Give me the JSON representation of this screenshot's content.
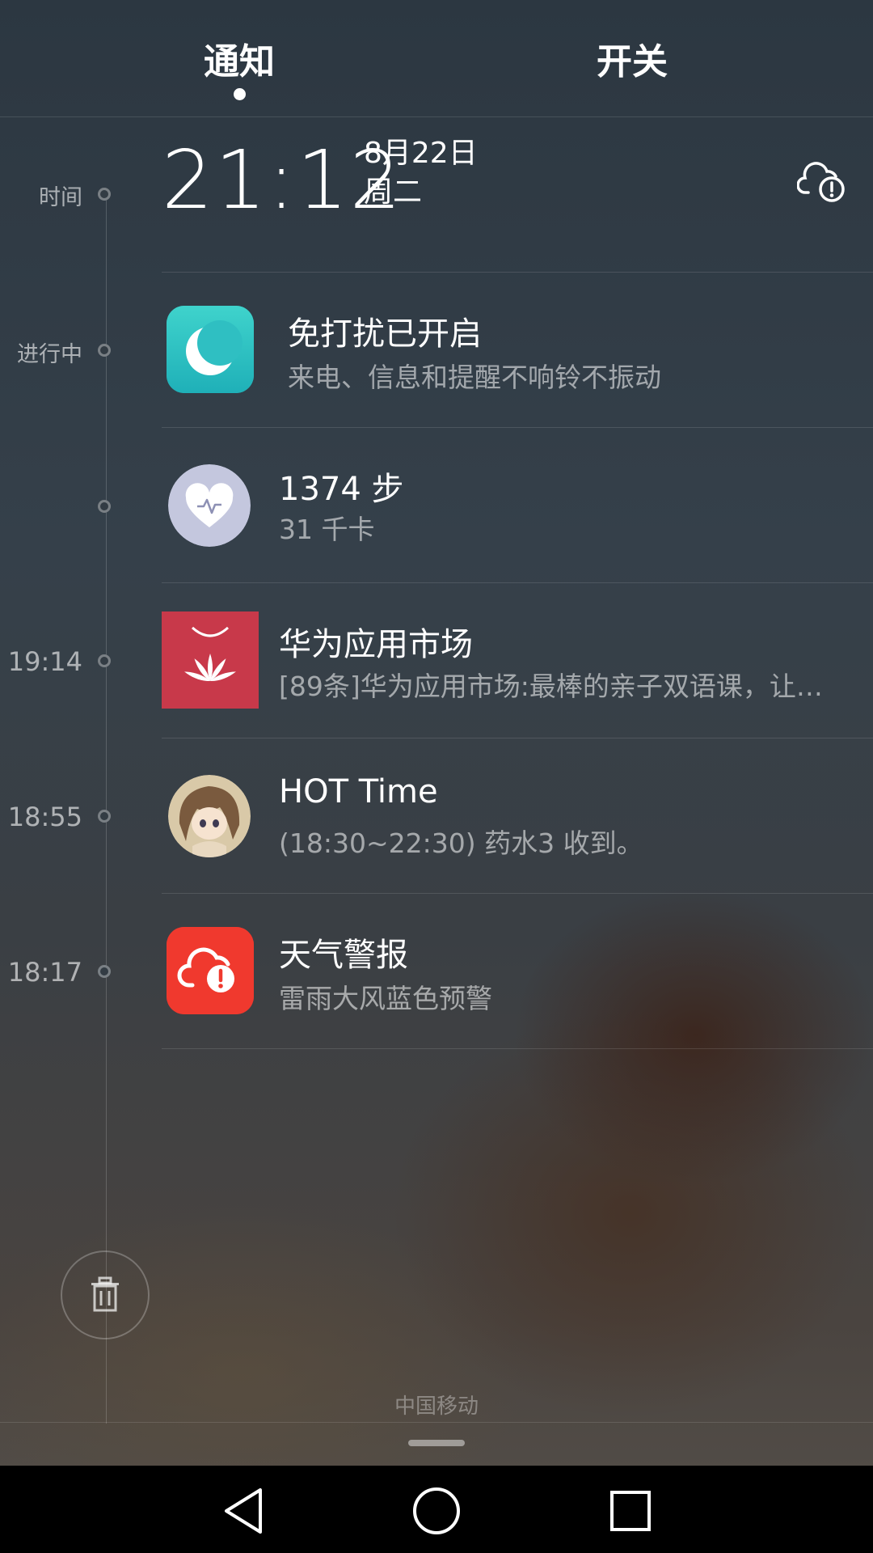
{
  "tabs": {
    "notify": "通知",
    "switch": "开关"
  },
  "timeline": {
    "time_label": "时间",
    "ongoing_label": "进行中",
    "t1": "19:14",
    "t2": "18:55",
    "t3": "18:17"
  },
  "clock": {
    "time": "21:12",
    "date": "8月22日",
    "weekday": "周二"
  },
  "notifications": [
    {
      "title": "免打扰已开启",
      "subtitle": "来电、信息和提醒不响铃不振动",
      "icon": "moon-icon",
      "color": "#2fc4c4"
    },
    {
      "title": "1374 步",
      "subtitle": "31 千卡",
      "icon": "heart-health-icon",
      "color": "#c7c9e0"
    },
    {
      "title": "华为应用市场",
      "subtitle": "[89条]华为应用市场:最棒的亲子双语课，让…",
      "icon": "huawei-appgallery-icon",
      "color": "#c8394a"
    },
    {
      "title": "HOT Time",
      "subtitle": "(18:30~22:30) 药水3 收到。",
      "icon": "anime-avatar-icon",
      "color": "#c9b79a"
    },
    {
      "title": "天气警报",
      "subtitle": "雷雨大风蓝色预警",
      "icon": "weather-alert-icon",
      "color": "#f0392e"
    }
  ],
  "carrier": "中国移动"
}
